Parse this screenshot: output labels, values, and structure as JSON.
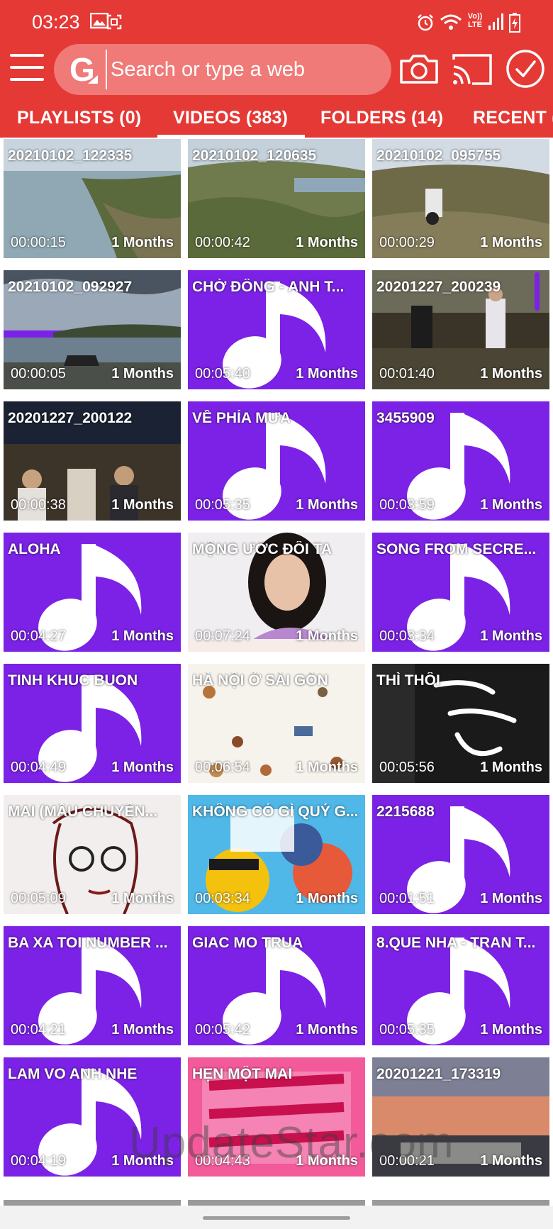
{
  "status_bar": {
    "time": "03:23",
    "icons": [
      "image-icon",
      "screenshot-icon",
      "alarm-icon",
      "wifi-icon",
      "volte-icon",
      "signal-icon",
      "battery-charging-icon"
    ],
    "volte_label_top": "Vo))",
    "volte_label_bottom": "LTE"
  },
  "toolbar": {
    "menu_icon": "hamburger-menu-icon",
    "search_placeholder": "Search or type a web",
    "logo_letter": "G",
    "camera_icon": "camera-icon",
    "cast_icon": "cast-icon",
    "select_icon": "checkmark-circle-icon"
  },
  "tabs": [
    {
      "label": "PLAYLISTS (0)",
      "active": false
    },
    {
      "label": "VIDEOS (383)",
      "active": true
    },
    {
      "label": "FOLDERS (14)",
      "active": false
    },
    {
      "label": "RECENT (",
      "active": false
    }
  ],
  "colors": {
    "primary": "#e53935",
    "music_tile": "#7b22e6",
    "text_on_primary": "#ffffff"
  },
  "videos": [
    {
      "title": "20210102_122335",
      "duration": "00:00:15",
      "age": "1 Months",
      "thumb": "coast-photo"
    },
    {
      "title": "20210102_120635",
      "duration": "00:00:42",
      "age": "1 Months",
      "thumb": "hills-photo"
    },
    {
      "title": "20210102_095755",
      "duration": "00:00:29",
      "age": "1 Months",
      "thumb": "motorbike-hill-photo"
    },
    {
      "title": "20210102_092927",
      "duration": "00:00:05",
      "age": "1 Months",
      "thumb": "sea-road-photo"
    },
    {
      "title": "CHỜ ĐÔNG - ANH T...",
      "duration": "00:05:40",
      "age": "1 Months",
      "thumb": "music-note"
    },
    {
      "title": "20201227_200239",
      "duration": "00:01:40",
      "age": "1 Months",
      "thumb": "wedding-photo"
    },
    {
      "title": "20201227_200122",
      "duration": "00:00:38",
      "age": "1 Months",
      "thumb": "party-photo"
    },
    {
      "title": "VỀ PHÍA MƯA",
      "duration": "00:05:35",
      "age": "1 Months",
      "thumb": "music-note"
    },
    {
      "title": "3455909",
      "duration": "00:03:59",
      "age": "1 Months",
      "thumb": "music-note"
    },
    {
      "title": "ALOHA",
      "duration": "00:04:27",
      "age": "1 Months",
      "thumb": "music-note"
    },
    {
      "title": "MỘNG ƯỚC ĐÔI TA",
      "duration": "00:07:24",
      "age": "1 Months",
      "thumb": "singer-album-art"
    },
    {
      "title": "SONG FROM SECRE...",
      "duration": "00:03:34",
      "age": "1 Months",
      "thumb": "music-note"
    },
    {
      "title": "TINH KHUC BUON",
      "duration": "00:04:49",
      "age": "1 Months",
      "thumb": "music-note"
    },
    {
      "title": "HÀ NỘI Ở SÀI GÒN",
      "duration": "00:06:54",
      "age": "1 Months",
      "thumb": "autumn-leaves-art"
    },
    {
      "title": "THÌ THÔI",
      "duration": "00:05:56",
      "age": "1 Months",
      "thumb": "calligraphy-art"
    },
    {
      "title": "MAI (MẦU CHUYỆN...",
      "duration": "00:05:09",
      "age": "1 Months",
      "thumb": "sketch-girl-art"
    },
    {
      "title": "KHÔNG CÓ GÌ QUÝ G...",
      "duration": "00:03:34",
      "age": "1 Months",
      "thumb": "comic-art"
    },
    {
      "title": "2215688",
      "duration": "00:01:51",
      "age": "1 Months",
      "thumb": "music-note"
    },
    {
      "title": "BA XA TOI NUMBER ...",
      "duration": "00:04:21",
      "age": "1 Months",
      "thumb": "music-note"
    },
    {
      "title": "GIAC MO TRUA",
      "duration": "00:05:42",
      "age": "1 Months",
      "thumb": "music-note"
    },
    {
      "title": "8.QUE NHA - TRAN T...",
      "duration": "00:05:35",
      "age": "1 Months",
      "thumb": "music-note"
    },
    {
      "title": "LAM VO ANH NHE",
      "duration": "00:04:19",
      "age": "1 Months",
      "thumb": "music-note"
    },
    {
      "title": "HẸN MỘT MAI",
      "duration": "00:04:43",
      "age": "1 Months",
      "thumb": "pink-poster-art"
    },
    {
      "title": "20201221_173319",
      "duration": "00:00:21",
      "age": "1 Months",
      "thumb": "sunset-photo"
    }
  ],
  "watermark": "UpdateStar.com"
}
